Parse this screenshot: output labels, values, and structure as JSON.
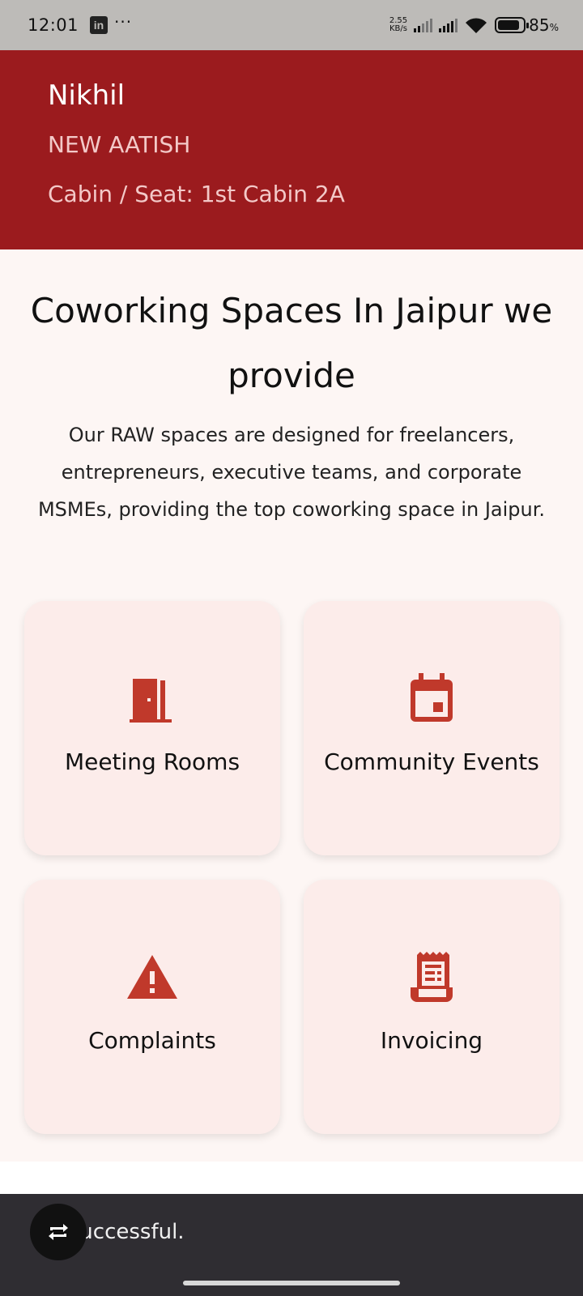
{
  "status_bar": {
    "time": "12:01",
    "app_badge": "in",
    "more": "···",
    "net_speed_value": "2.55",
    "net_speed_unit": "KB/s",
    "battery": "85",
    "battery_unit": "%"
  },
  "header": {
    "name": "Nikhil",
    "company": "NEW AATISH",
    "cabin": "Cabin / Seat: 1st Cabin 2A"
  },
  "main": {
    "title": "Coworking Spaces In Jaipur we provide",
    "description": "Our RAW spaces are designed for freelancers, entrepreneurs, executive teams, and corporate MSMEs, providing the top coworking space in Jaipur.",
    "cards": [
      {
        "label": "Meeting Rooms",
        "icon": "door-icon"
      },
      {
        "label": "Community Events",
        "icon": "calendar-icon"
      },
      {
        "label": "Complaints",
        "icon": "warning-icon"
      },
      {
        "label": "Invoicing",
        "icon": "receipt-icon"
      }
    ]
  },
  "snackbar": {
    "message": "Login successful.",
    "visible_text": "n successful."
  },
  "colors": {
    "header_bg": "#9b1b1e",
    "accent": "#c0392b",
    "card_bg": "#fcecea",
    "page_bg": "#fdf6f4"
  }
}
